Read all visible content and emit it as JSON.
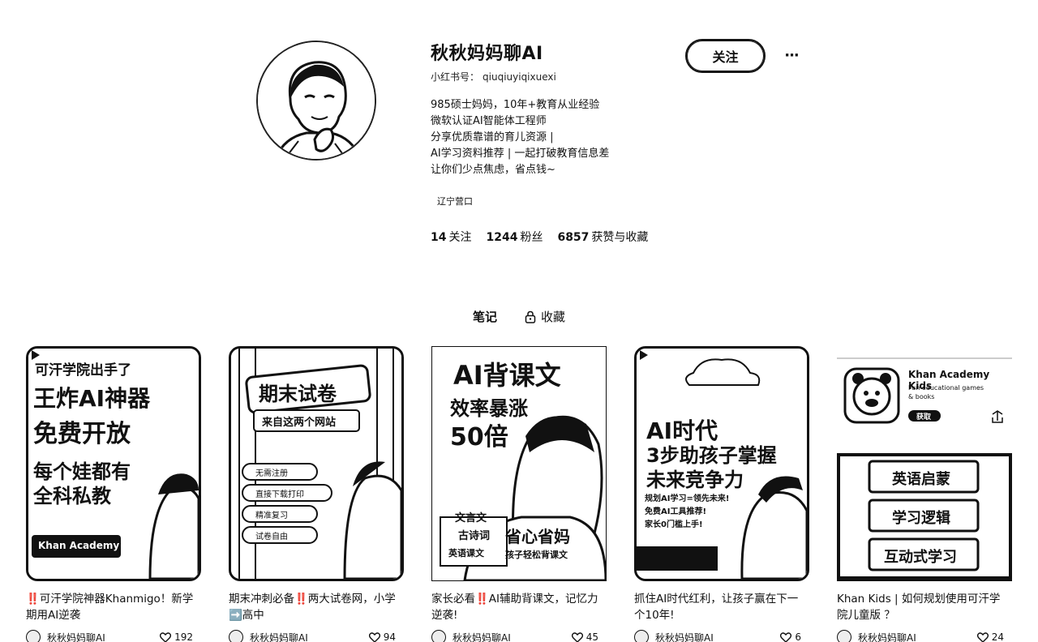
{
  "profile": {
    "name": "秋秋妈妈聊AI",
    "id_label": "小红书号：",
    "id_value": "qiuqiuyiqixuexi",
    "bio": [
      "985硕士妈妈，10年+教育从业经验",
      "微软认证AI智能体工程师",
      "分享优质靠谱的育儿资源 |",
      "AI学习资料推荐 | 一起打破教育信息差",
      "让你们少点焦虑，省点钱~"
    ],
    "location": "辽宁营口",
    "stats": [
      {
        "value": "14",
        "label": "关注"
      },
      {
        "value": "1244",
        "label": "粉丝"
      },
      {
        "value": "6857",
        "label": "获赞与收藏"
      }
    ],
    "follow_label": "关注",
    "more_label": "···"
  },
  "tabs": [
    {
      "label": "笔记",
      "active": true,
      "icon": null
    },
    {
      "label": "收藏",
      "active": false,
      "icon": "lock-icon"
    }
  ],
  "cards": [
    {
      "title": "‼️可汗学院神器Khanmigo！新学期用AI逆袭",
      "author": "秋秋妈妈聊AI",
      "likes": "192",
      "cover_lines": [
        "可汗学院出手了",
        "王炸AI神器",
        "免费开放",
        "每个娃都有",
        "全科私教"
      ],
      "badge": "Khan Academy"
    },
    {
      "title": "期末冲刺必备‼️两大试卷网，小学➡️高中",
      "author": "秋秋妈妈聊AI",
      "likes": "94",
      "cover_lines": [
        "期末试卷",
        "来自这两个网站",
        "无需注册",
        "直接下载打印",
        "精准复习",
        "试卷自由"
      ]
    },
    {
      "title": "家长必看‼️AI辅助背课文，记忆力逆袭!",
      "author": "秋秋妈妈聊AI",
      "likes": "45",
      "cover_lines": [
        "AI背课文",
        "效率暴涨",
        "50倍",
        "文言文",
        "古诗词",
        "省心省妈",
        "英语课文",
        "孩子轻松背课文"
      ]
    },
    {
      "title": "抓住AI时代红利，让孩子赢在下一个10年!",
      "author": "秋秋妈妈聊AI",
      "likes": "6",
      "cover_lines": [
        "AI时代",
        "3步助孩子掌握",
        "未来竞争力",
        "规划AI学习=领先未来!",
        "免费AI工具推荐!",
        "家长0门槛上手!"
      ]
    },
    {
      "title": "Khan Kids | 如何规划使用可汗学院儿童版 ？",
      "author": "秋秋妈妈聊AI",
      "likes": "24",
      "cover_lines": [
        "Khan Academy Kids",
        "Fun educational games & books",
        "获取",
        "英语启蒙",
        "学习逻辑",
        "互动式学习"
      ]
    }
  ]
}
